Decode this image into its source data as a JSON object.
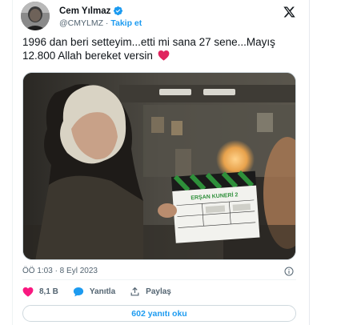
{
  "tweet": {
    "author_name": "Cem Yılmaz",
    "author_handle": "@CMYLMZ",
    "separator": " · ",
    "follow_label": "Takip et",
    "text": "1996 dan beri setteyim...etti mi  sana 27 sene...Mayış 12.800 Allah bereket versin",
    "timestamp": "ÖÖ 1:03 · 8 Eyl 2023"
  },
  "media": {
    "clapper_title": "ERŞAN KUNERİ 2"
  },
  "actions": {
    "likes": "8,1 B",
    "reply_label": "Yanıtla",
    "share_label": "Paylaş"
  },
  "replies_button": "602 yanıtı oku",
  "colors": {
    "accent": "#1d9bf0",
    "like": "#f91880",
    "heart_emoji": "#e0245e",
    "text": "#0f1419",
    "muted": "#536471"
  },
  "icons": [
    "x-logo-icon",
    "verified-badge-icon",
    "red-heart-emoji-icon",
    "like-heart-icon",
    "reply-bubble-icon",
    "share-icon",
    "info-icon"
  ]
}
